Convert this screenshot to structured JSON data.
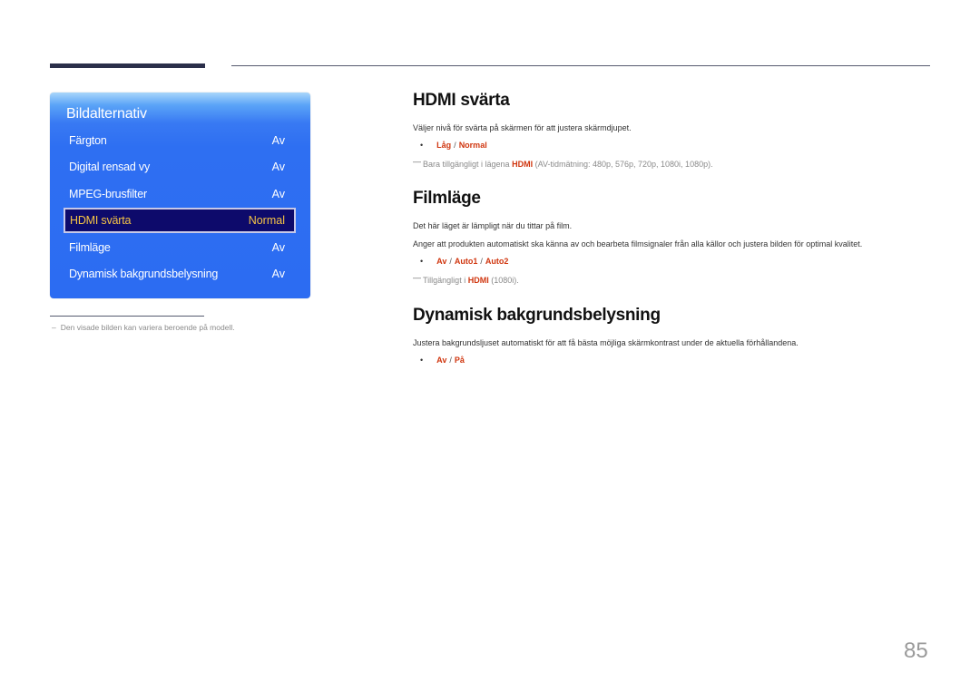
{
  "osd_menu": {
    "title": "Bildalternativ",
    "items": [
      {
        "label": "Färgton",
        "value": "Av",
        "selected": false
      },
      {
        "label": "Digital rensad vy",
        "value": "Av",
        "selected": false
      },
      {
        "label": "MPEG-brusfilter",
        "value": "Av",
        "selected": false
      },
      {
        "label": "HDMI svärta",
        "value": "Normal",
        "selected": true
      },
      {
        "label": "Filmläge",
        "value": "Av",
        "selected": false
      },
      {
        "label": "Dynamisk bakgrundsbelysning",
        "value": "Av",
        "selected": false
      }
    ]
  },
  "footnote": {
    "dash": "–",
    "text": "Den visade bilden kan variera beroende på modell."
  },
  "sections": {
    "hdmi": {
      "title": "HDMI svärta",
      "description": "Väljer nivå för svärta på skärmen för att justera skärmdjupet.",
      "options": [
        "Låg",
        "Normal"
      ],
      "availability": {
        "prefix": "Bara tillgängligt i lägena",
        "highlight": "HDMI",
        "suffix": "(AV-tidmätning: 480p, 576p, 720p, 1080i, 1080p)."
      }
    },
    "film": {
      "title": "Filmläge",
      "description1": "Det här läget är lämpligt när du tittar på film.",
      "description2": "Anger att produkten automatiskt ska känna av och bearbeta filmsignaler från alla källor och justera bilden för optimal kvalitet.",
      "options": [
        "Av",
        "Auto1",
        "Auto2"
      ],
      "availability": {
        "prefix": "Tillgängligt i",
        "highlight": "HDMI",
        "suffix": "(1080i)."
      }
    },
    "backlight": {
      "title": "Dynamisk bakgrundsbelysning",
      "description": "Justera bakgrundsljuset automatiskt för att få bästa möjliga skärmkontrast under de aktuella förhållandena.",
      "options": [
        "Av",
        "På"
      ]
    }
  },
  "bullet": "•",
  "option_separator": "/",
  "note_mark": "—",
  "page_number": "85",
  "colors": {
    "accent": "#d0360f",
    "osd_blue": "#2c6cf2",
    "osd_selected_bg": "#0d0a6b",
    "osd_selected_text": "#f6c545"
  }
}
